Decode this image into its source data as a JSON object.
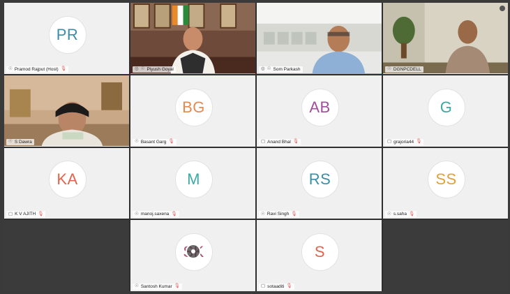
{
  "participants": [
    {
      "initials": "PR",
      "name": "Pramod Rajput (Host)",
      "color": "#3b8ea5",
      "type": "avatar"
    },
    {
      "name": "Piyush Goyal",
      "type": "video",
      "scene": "office-portraits",
      "active": true
    },
    {
      "name": "Som Parkash",
      "type": "video",
      "scene": "office-blinds",
      "active": true
    },
    {
      "name": "DGNPCDELL",
      "type": "video",
      "scene": "office-green"
    },
    {
      "name": "S Dawra",
      "type": "video",
      "scene": "office-woman"
    },
    {
      "initials": "BG",
      "name": "Basant Garg",
      "color": "#e58a4e",
      "type": "avatar"
    },
    {
      "initials": "AB",
      "name": "Anand Bhal",
      "color": "#a0509a",
      "type": "avatar"
    },
    {
      "initials": "G",
      "name": "grajoria44",
      "color": "#3ba9a3",
      "type": "avatar"
    },
    {
      "initials": "KA",
      "name": "K V AJITH",
      "color": "#e0654d",
      "type": "avatar"
    },
    {
      "initials": "M",
      "name": "manoj.saxena",
      "color": "#3ba9a3",
      "type": "avatar"
    },
    {
      "initials": "RS",
      "name": "Ravi Singh",
      "color": "#3b8ea5",
      "type": "avatar"
    },
    {
      "initials": "SS",
      "name": "s.saha",
      "color": "#e0a13c",
      "type": "avatar"
    },
    {
      "type": "empty"
    },
    {
      "initials": "SK",
      "name": "Santosh Kumar",
      "color": "#b05070",
      "type": "avatar",
      "loading": true
    },
    {
      "initials": "S",
      "name": "sotaaditi",
      "color": "#e0654d",
      "type": "avatar"
    },
    {
      "type": "empty"
    }
  ]
}
